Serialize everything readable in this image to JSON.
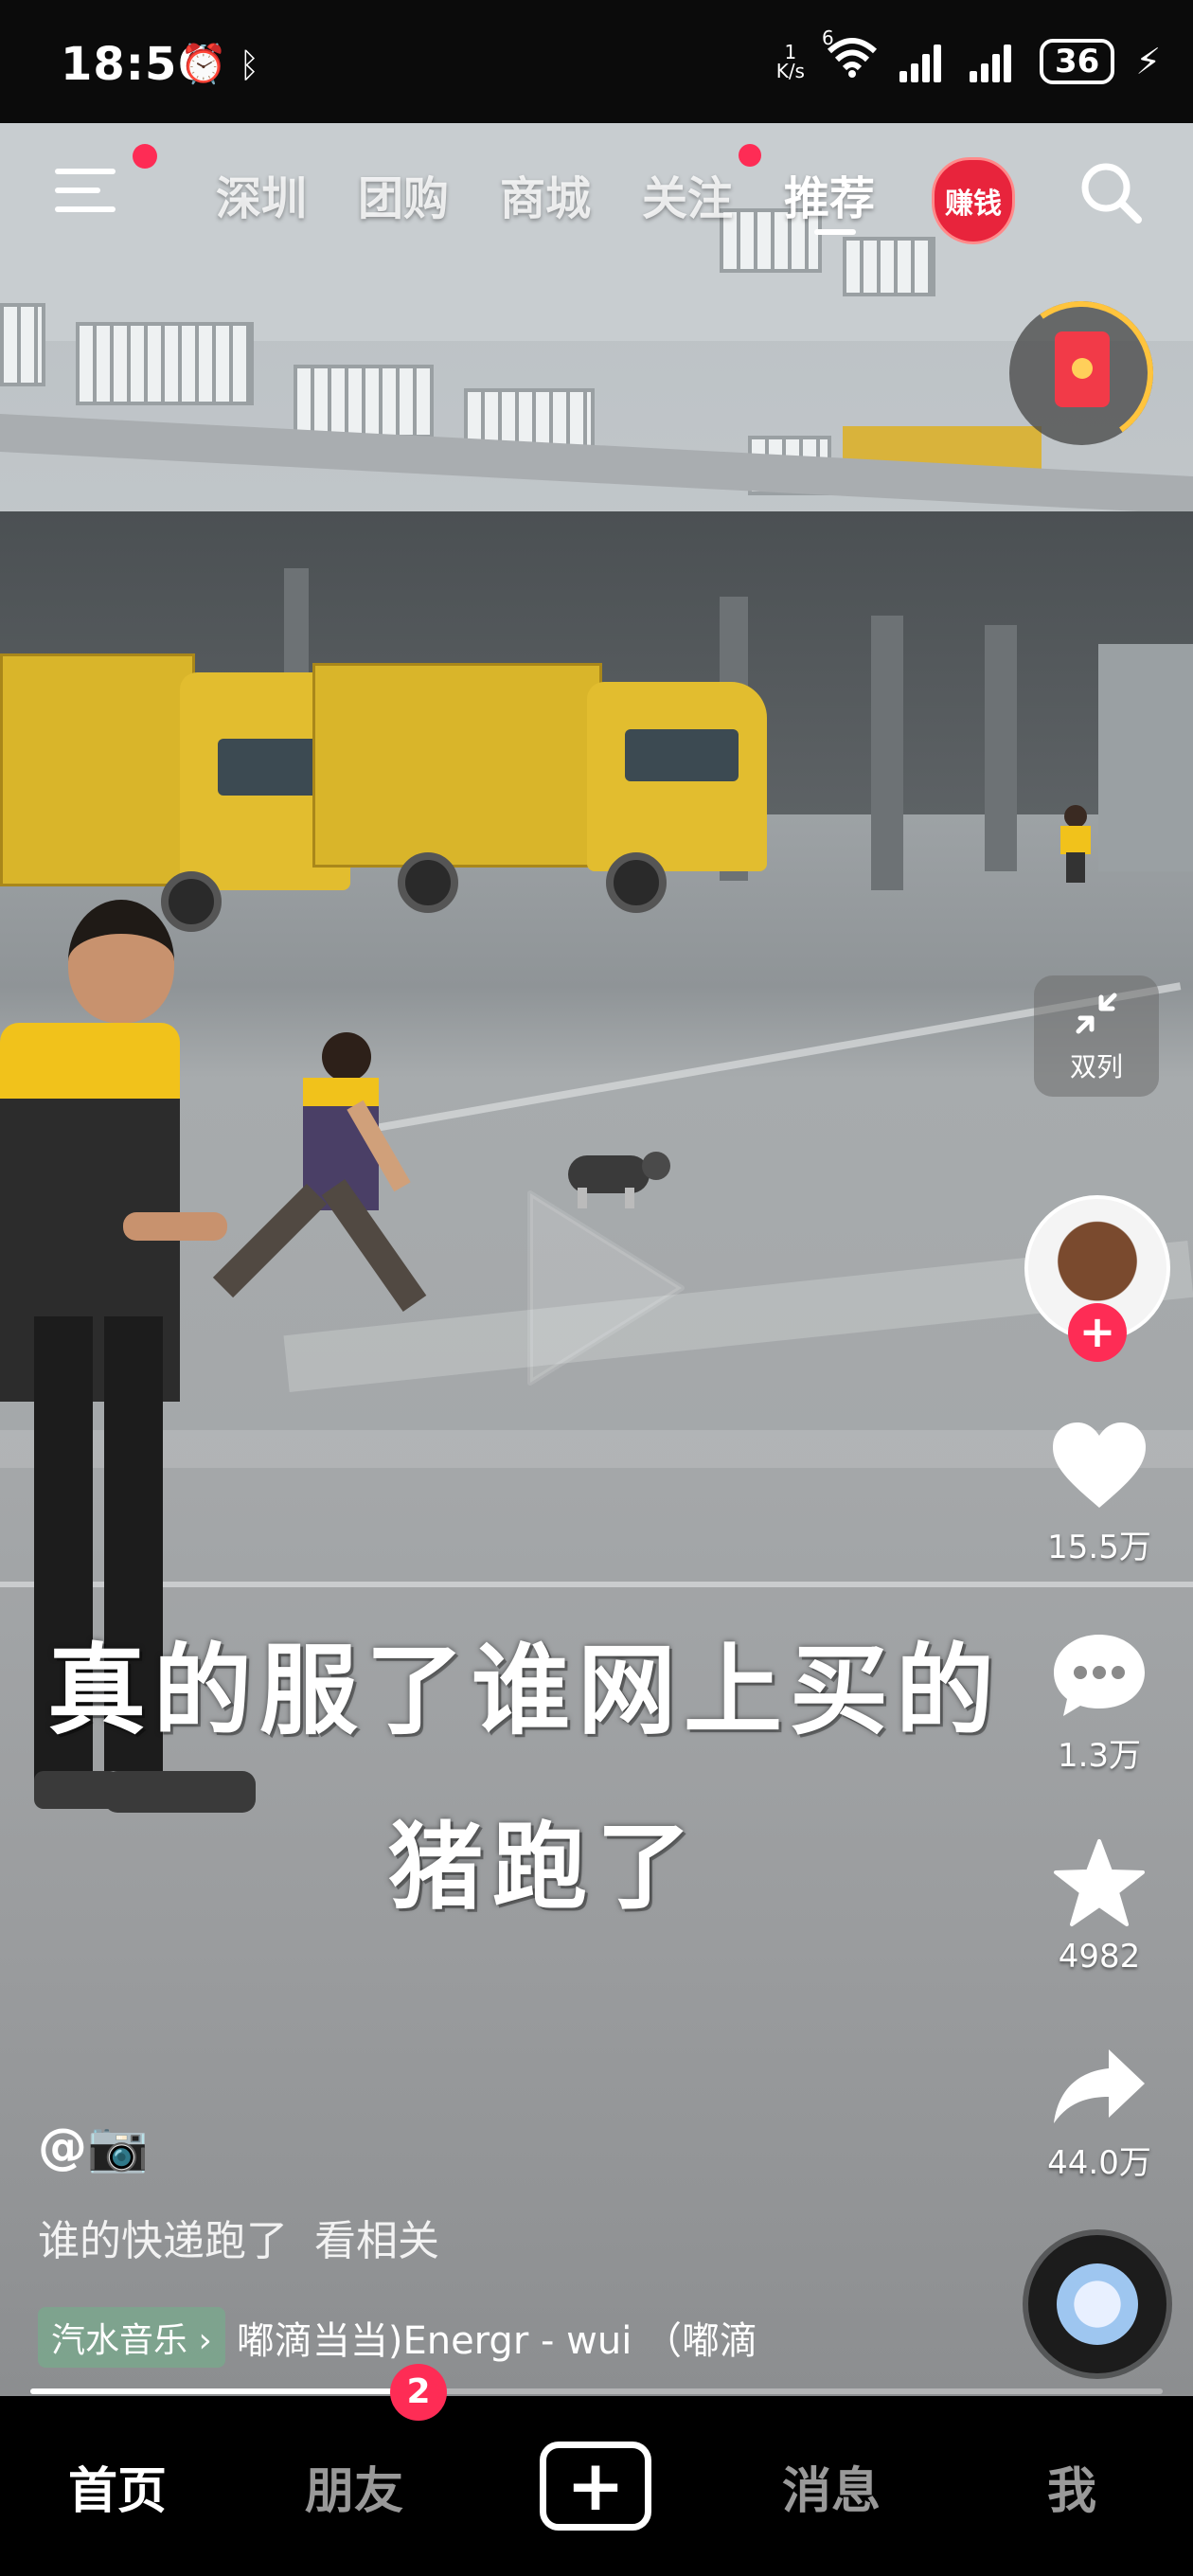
{
  "status_bar": {
    "time": "18:56",
    "net_speed_value": "1",
    "net_speed_unit": "K/s",
    "wifi_label": "6",
    "battery": "36"
  },
  "top_nav": {
    "tabs": [
      {
        "label": "深圳"
      },
      {
        "label": "团购"
      },
      {
        "label": "商城"
      },
      {
        "label": "关注"
      },
      {
        "label": "推荐"
      }
    ],
    "active_tab": "推荐",
    "earn_label": "赚钱"
  },
  "side": {
    "dual_column_label": "双列",
    "likes": "15.5万",
    "comments": "1.3万",
    "favorites": "4982",
    "shares": "44.0万"
  },
  "video": {
    "subtitle_line1": "真的服了谁网上买的",
    "subtitle_line2": "猪跑了",
    "author": "@📷",
    "description": "谁的快递跑了",
    "related_link": "看相关",
    "music_badge": "汽水音乐 ›",
    "music_text": "嘟滴当当)Energr - wui （嘟滴",
    "progress": 0.33
  },
  "tab_bar": {
    "home": "首页",
    "friends": "朋友",
    "friends_badge": "2",
    "create": "+",
    "messages": "消息",
    "me": "我"
  },
  "colors": {
    "accent": "#fe2c55",
    "truck_yellow": "#d9b52a",
    "uniform_yellow": "#f1c21b"
  }
}
